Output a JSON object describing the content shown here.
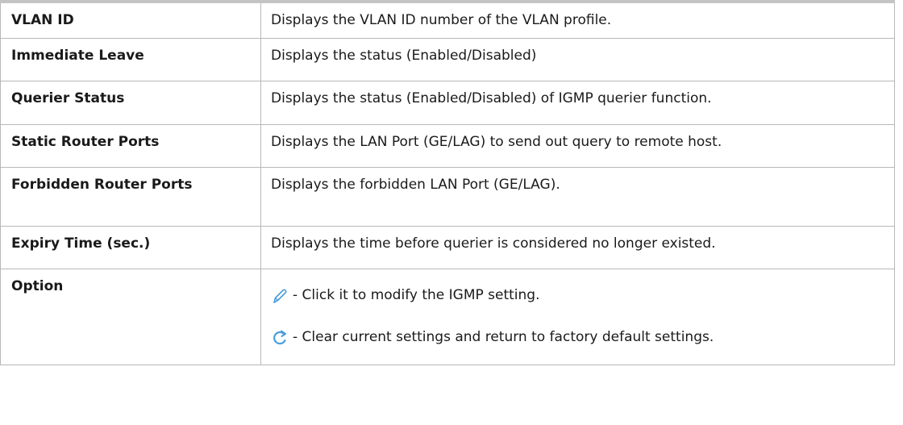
{
  "rows": [
    {
      "term": "VLAN ID",
      "desc": "Displays the VLAN ID number of the VLAN profile."
    },
    {
      "term": "Immediate Leave",
      "desc": "Displays the status (Enabled/Disabled)"
    },
    {
      "term": "Querier Status",
      "desc": "Displays the status (Enabled/Disabled) of IGMP querier function."
    },
    {
      "term": "Static Router Ports",
      "desc": "Displays the LAN Port (GE/LAG) to send out query to remote host."
    },
    {
      "term": "Forbidden Router Ports",
      "desc": "Displays the forbidden LAN Port (GE/LAG)."
    },
    {
      "term": "Expiry Time (sec.)",
      "desc": "Displays the time before querier is considered no longer existed."
    },
    {
      "term": "Option",
      "options": [
        {
          "icon": "edit-pencil-icon",
          "text": "- Click it to modify the IGMP setting."
        },
        {
          "icon": "refresh-icon",
          "text": "- Clear current settings and return to factory default settings."
        }
      ]
    }
  ],
  "colors": {
    "border": "#b8b8b8",
    "icon": "#4a9fdc",
    "text": "#1a1a1a"
  }
}
